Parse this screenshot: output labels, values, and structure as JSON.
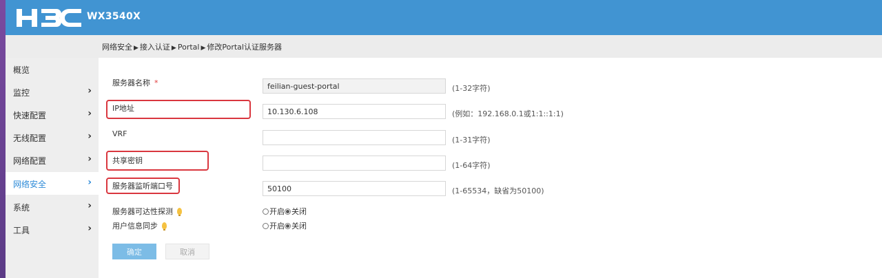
{
  "header": {
    "brand": "H3C",
    "product": "WX3540X",
    "color": "#4194d2"
  },
  "breadcrumb": [
    "网络安全",
    "接入认证",
    "Portal",
    "修改Portal认证服务器"
  ],
  "breadcrumb_separator_icon": "caret-right-icon",
  "sidebar": {
    "items": [
      {
        "label": "概览",
        "chevron": false,
        "active": false
      },
      {
        "label": "监控",
        "chevron": true,
        "active": false
      },
      {
        "label": "快速配置",
        "chevron": true,
        "active": false
      },
      {
        "label": "无线配置",
        "chevron": true,
        "active": false
      },
      {
        "label": "网络配置",
        "chevron": true,
        "active": false
      },
      {
        "label": "网络安全",
        "chevron": true,
        "active": true
      },
      {
        "label": "系统",
        "chevron": true,
        "active": false
      },
      {
        "label": "工具",
        "chevron": true,
        "active": false
      }
    ],
    "active_color": "#2e8bd8"
  },
  "form": {
    "server_name": {
      "label": "服务器名称",
      "required_mark": "*",
      "value": "feilian-guest-portal",
      "hint": "(1-32字符)"
    },
    "ip": {
      "label": "IP地址",
      "value": "10.130.6.108",
      "hint": "(例如：192.168.0.1或1:1::1:1)"
    },
    "vrf": {
      "label": "VRF",
      "value": "",
      "hint": "(1-31字符)"
    },
    "shared_key": {
      "label": "共享密钥",
      "value": "",
      "hint": "(1-64字符)"
    },
    "port": {
      "label": "服务器监听端口号",
      "value": "50100",
      "hint": "(1-65534，缺省为50100)"
    },
    "reachability": {
      "label": "服务器可达性探测",
      "on_label": "开启",
      "off_label": "关闭",
      "selected": "关闭"
    },
    "user_sync": {
      "label": "用户信息同步",
      "on_label": "开启",
      "off_label": "关闭",
      "selected": "关闭"
    },
    "highlight_color": "#d9363e"
  },
  "buttons": {
    "ok": "确定",
    "cancel": "取消"
  }
}
